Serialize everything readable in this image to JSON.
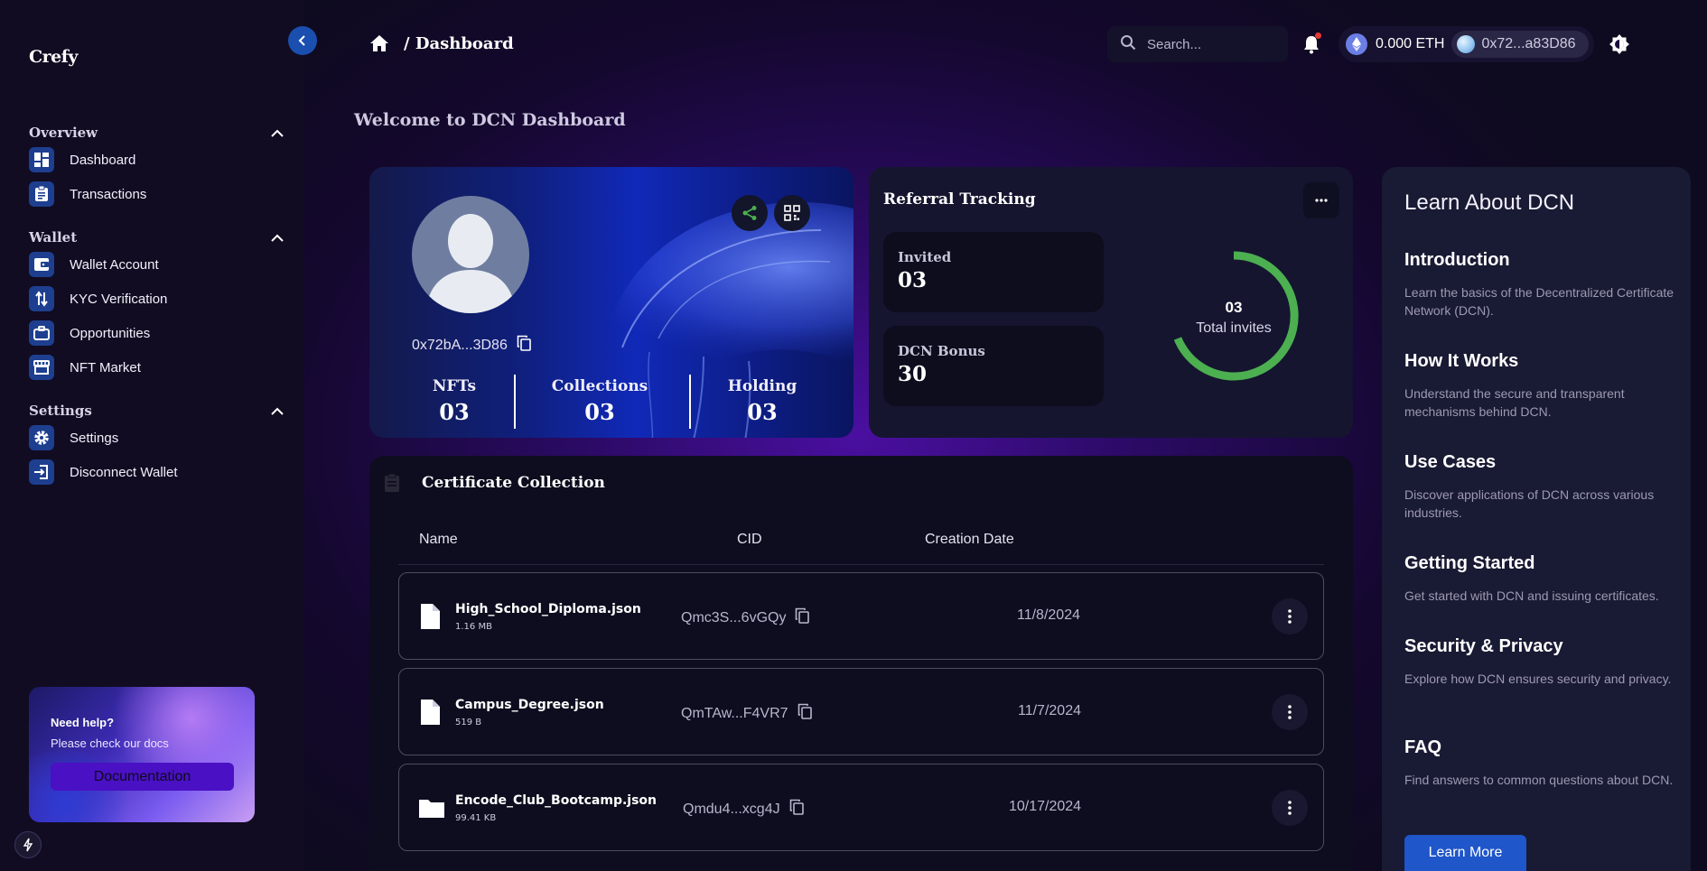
{
  "sidebar": {
    "brand": "Crefy",
    "sections": [
      {
        "label": "Overview",
        "items": [
          {
            "label": "Dashboard",
            "icon": "dashboard-icon"
          },
          {
            "label": "Transactions",
            "icon": "clipboard-icon"
          }
        ]
      },
      {
        "label": "Wallet",
        "items": [
          {
            "label": "Wallet Account",
            "icon": "wallet-icon"
          },
          {
            "label": "KYC Verification",
            "icon": "swap-vertical-icon"
          },
          {
            "label": "Opportunities",
            "icon": "briefcase-icon"
          },
          {
            "label": "NFT Market",
            "icon": "store-icon"
          }
        ]
      },
      {
        "label": "Settings",
        "items": [
          {
            "label": "Settings",
            "icon": "gear-icon"
          },
          {
            "label": "Disconnect Wallet",
            "icon": "logout-icon"
          }
        ]
      }
    ],
    "help": {
      "title": "Need help?",
      "subtitle": "Please check our docs",
      "button": "Documentation"
    }
  },
  "header": {
    "breadcrumb": "/ Dashboard",
    "search_placeholder": "Search...",
    "eth_balance": "0.000 ETH",
    "wallet_address": "0x72...a83D86"
  },
  "welcome": "Welcome to DCN Dashboard",
  "profile": {
    "address": "0x72bA...3D86",
    "stats": [
      {
        "label": "NFTs",
        "value": "03"
      },
      {
        "label": "Collections",
        "value": "03"
      },
      {
        "label": "Holding",
        "value": "03"
      }
    ]
  },
  "referral": {
    "title": "Referral Tracking",
    "invited_label": "Invited",
    "invited_value": "03",
    "bonus_label": "DCN Bonus",
    "bonus_value": "30",
    "total_value": "03",
    "total_label": "Total invites",
    "ring_color": "#4caf50"
  },
  "certificates": {
    "title": "Certificate Collection",
    "columns": [
      "Name",
      "CID",
      "Creation Date"
    ],
    "rows": [
      {
        "name": "High_School_Diploma.json",
        "size": "1.16 MB",
        "cid": "Qmc3S...6vGQy",
        "date": "11/8/2024",
        "type": "file"
      },
      {
        "name": "Campus_Degree.json",
        "size": "519 B",
        "cid": "QmTAw...F4VR7",
        "date": "11/7/2024",
        "type": "file"
      },
      {
        "name": "Encode_Club_Bootcamp.json",
        "size": "99.41 KB",
        "cid": "Qmdu4...xcg4J",
        "date": "10/17/2024",
        "type": "folder"
      }
    ]
  },
  "learn": {
    "title": "Learn About DCN",
    "topics": [
      {
        "heading": "Introduction",
        "desc": "Learn the basics of the Decentralized Certificate Network (DCN)."
      },
      {
        "heading": "How It Works",
        "desc": "Understand the secure and transparent mechanisms behind DCN."
      },
      {
        "heading": "Use Cases",
        "desc": "Discover applications of DCN across various industries."
      },
      {
        "heading": "Getting Started",
        "desc": "Get started with DCN and issuing certificates."
      },
      {
        "heading": "Security & Privacy",
        "desc": "Explore how DCN ensures security and privacy."
      },
      {
        "heading": "FAQ",
        "desc": "Find answers to common questions about DCN."
      }
    ],
    "button": "Learn More"
  }
}
